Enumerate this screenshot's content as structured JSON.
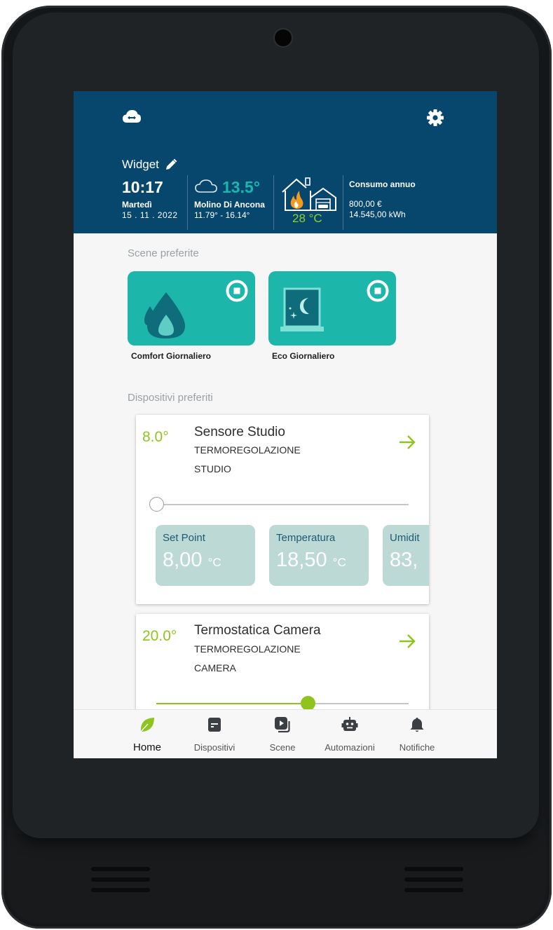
{
  "colors": {
    "header_bg": "#07476e",
    "accent_teal": "#1cb6aa",
    "accent_green": "#8fc41f",
    "weather_temp": "#18b7b0",
    "metric_card_bg": "#bcd9d5",
    "metric_label": "#1d5b73"
  },
  "header": {
    "cloud_icon": "cloud-sync-icon",
    "settings_icon": "gear-icon",
    "widget_title": "Widget",
    "edit_icon": "pencil-icon",
    "time": "10:17",
    "day": "Martedì",
    "date": "15 . 11 . 2022",
    "weather": {
      "icon": "cloud-icon",
      "temperature": "13.5°",
      "location": "Molino Di Ancona",
      "range": "11.79° - 16.14°"
    },
    "house": {
      "icon": "house-heating-garage-icon",
      "temperature": "28 °C"
    },
    "consumption": {
      "title": "Consumo annuo",
      "cost": "800,00 €",
      "energy": "14.545,00 kWh"
    }
  },
  "scenes": {
    "section_title": "Scene preferite",
    "items": [
      {
        "label": "Comfort Giornaliero",
        "icon": "water-drops-icon"
      },
      {
        "label": "Eco Giornaliero",
        "icon": "night-window-icon"
      }
    ]
  },
  "devices": {
    "section_title": "Dispositivi preferiti",
    "items": [
      {
        "temperature": "8.0°",
        "name": "Sensore Studio",
        "category": "TERMOREGOLAZIONE",
        "room": "STUDIO",
        "slider_level": 0.0,
        "metrics": [
          {
            "label": "Set Point",
            "value": "8,00",
            "unit": "°C"
          },
          {
            "label": "Temperatura",
            "value": "18,50",
            "unit": "°C"
          },
          {
            "label": "Umidit",
            "value": "83,",
            "unit": ""
          }
        ]
      },
      {
        "temperature": "20.0°",
        "name": "Termostatica Camera",
        "category": "TERMOREGOLAZIONE",
        "room": "CAMERA",
        "slider_level": 0.6
      }
    ]
  },
  "nav": {
    "items": [
      {
        "label": "Home",
        "icon": "leaf-icon",
        "active": true
      },
      {
        "label": "Dispositivi",
        "icon": "device-panel-icon",
        "active": false
      },
      {
        "label": "Scene",
        "icon": "scene-play-icon",
        "active": false
      },
      {
        "label": "Automazioni",
        "icon": "robot-icon",
        "active": false
      },
      {
        "label": "Notifiche",
        "icon": "bell-icon",
        "active": false
      }
    ]
  }
}
